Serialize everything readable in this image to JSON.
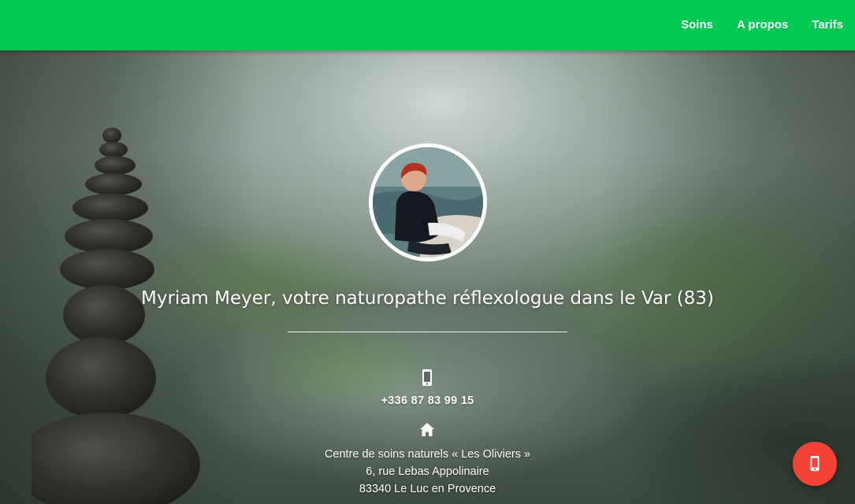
{
  "nav": {
    "items": [
      {
        "label": "Soins"
      },
      {
        "label": "A propos"
      },
      {
        "label": "Tarifs"
      }
    ]
  },
  "hero": {
    "title": "Myriam Meyer, votre naturopathe réflexologue dans le Var (83)",
    "avatar_icon": "profile-photo",
    "phone_icon": "mobile-phone-icon",
    "phone": "+336 87 83 99 15",
    "home_icon": "home-icon",
    "address": {
      "line1": "Centre de soins naturels « Les Oliviers »",
      "line2": "6, rue Lebas Appolinaire",
      "line3": "83340 Le Luc en Provence"
    }
  },
  "fab": {
    "icon": "mobile-phone-icon"
  },
  "colors": {
    "navbar": "#00c853",
    "fab": "#f44336",
    "text": "#ffffff"
  }
}
